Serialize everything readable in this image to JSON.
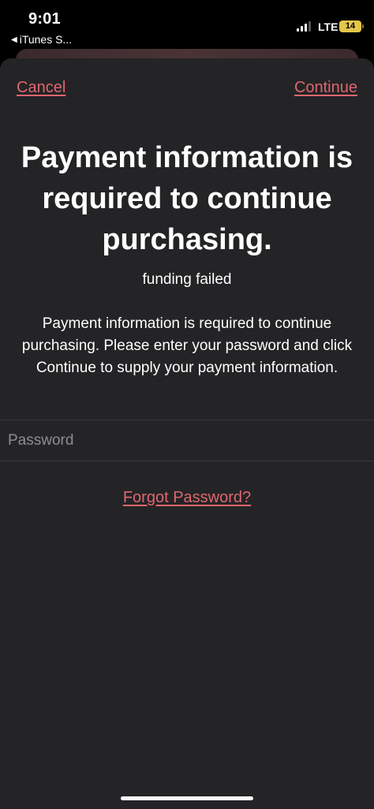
{
  "status_bar": {
    "time": "9:01",
    "back_app": "iTunes S...",
    "network": "LTE",
    "battery": "14"
  },
  "sheet": {
    "cancel_label": "Cancel",
    "continue_label": "Continue",
    "title": "Payment information is required to continue purchasing.",
    "subtitle": "funding failed",
    "message": "Payment information is required to continue purchasing. Please enter your password and click Continue to supply your payment information.",
    "password_placeholder": "Password",
    "forgot_label": "Forgot Password?"
  },
  "colors": {
    "accent": "#e0666f",
    "sheet_bg": "#242426",
    "battery": "#e5c64b"
  }
}
